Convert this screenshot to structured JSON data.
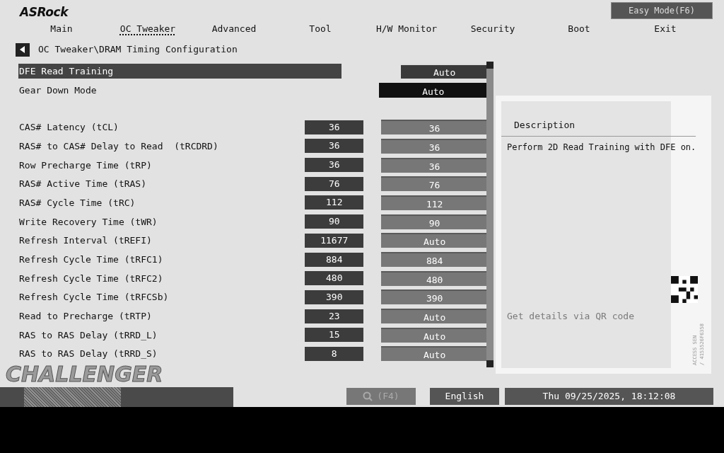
{
  "brand": "ASRock",
  "mode_button": "Easy Mode(F6)",
  "tabs": [
    {
      "label": "Main",
      "selected": false
    },
    {
      "label": "OC Tweaker",
      "selected": true
    },
    {
      "label": "Advanced",
      "selected": false
    },
    {
      "label": "Tool",
      "selected": false
    },
    {
      "label": "H/W Monitor",
      "selected": false
    },
    {
      "label": "Security",
      "selected": false
    },
    {
      "label": "Boot",
      "selected": false
    },
    {
      "label": "Exit",
      "selected": false
    }
  ],
  "breadcrumb": "OC Tweaker\\DRAM Timing Configuration",
  "settings": [
    {
      "kind": "option",
      "label": "DFE Read Training",
      "value": "Auto",
      "selected": true
    },
    {
      "kind": "option",
      "label": "Gear Down Mode",
      "value": "Auto",
      "selected": false
    },
    {
      "kind": "spacer"
    },
    {
      "kind": "timing",
      "label": "CAS# Latency (tCL)",
      "current": "36",
      "value": "36",
      "selected": false
    },
    {
      "kind": "timing",
      "label": "RAS# to CAS# Delay to Read  (tRCDRD)",
      "current": "36",
      "value": "36",
      "selected": false
    },
    {
      "kind": "timing",
      "label": "Row Precharge Time (tRP)",
      "current": "36",
      "value": "36",
      "selected": false
    },
    {
      "kind": "timing",
      "label": "RAS# Active Time (tRAS)",
      "current": "76",
      "value": "76",
      "selected": false
    },
    {
      "kind": "timing",
      "label": "RAS# Cycle Time (tRC)",
      "current": "112",
      "value": "112",
      "selected": false
    },
    {
      "kind": "timing",
      "label": "Write Recovery Time (tWR)",
      "current": "90",
      "value": "90",
      "selected": false
    },
    {
      "kind": "timing",
      "label": "Refresh Interval (tREFI)",
      "current": "11677",
      "value": "Auto",
      "selected": false
    },
    {
      "kind": "timing",
      "label": "Refresh Cycle Time (tRFC1)",
      "current": "884",
      "value": "884",
      "selected": false
    },
    {
      "kind": "timing",
      "label": "Refresh Cycle Time (tRFC2)",
      "current": "480",
      "value": "480",
      "selected": false
    },
    {
      "kind": "timing",
      "label": "Refresh Cycle Time (tRFCSb)",
      "current": "390",
      "value": "390",
      "selected": false
    },
    {
      "kind": "timing",
      "label": "Read to Precharge (tRTP)",
      "current": "23",
      "value": "Auto",
      "selected": false
    },
    {
      "kind": "timing",
      "label": "RAS to RAS Delay (tRRD_L)",
      "current": "15",
      "value": "Auto",
      "selected": false
    },
    {
      "kind": "timing",
      "label": "RAS to RAS Delay (tRRD_S)",
      "current": "8",
      "value": "Auto",
      "selected": false
    }
  ],
  "description": {
    "title": "Description",
    "text": "Perform 2D Read Training with DFE on.",
    "qr_hint": "Get details via QR code",
    "access_lines": [
      "ACCESS SEN",
      "/ 4153526F6358"
    ]
  },
  "board_logo": "CHALLENGER",
  "footer": {
    "search_key": "(F4)",
    "language": "English",
    "datetime": "Thu 09/25/2025, 18:12:08"
  }
}
